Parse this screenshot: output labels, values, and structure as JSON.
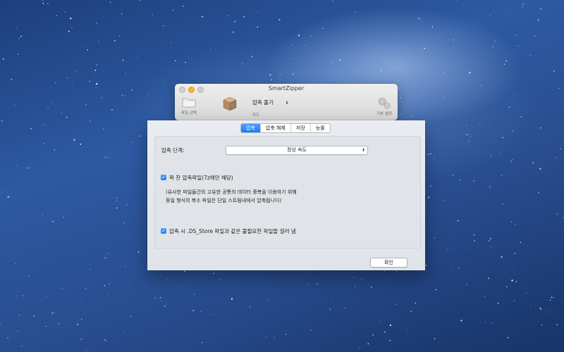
{
  "app": {
    "title": "SmartZipper"
  },
  "toolbar": {
    "file_label": "파일 선택",
    "mode_value": "압축 풀기",
    "mode_label": "모드",
    "settings_label": "기본 설정"
  },
  "preferences": {
    "tabs": [
      "압축",
      "압축 해제",
      "저장",
      "능률"
    ],
    "active_tab": "압축",
    "level_label": "압축 단계:",
    "level_value": "정상 속도",
    "solid_option": "꽉 찬 압축파일(7z에만 해당)",
    "solid_checked": true,
    "solid_desc_line1": "(유사한 파일들간의 고유한 공통의 데이터 중복을 이용하기 위해",
    "solid_desc_line2": "동일 형식의 복수 파일은 단일 스트림내에서 압축됩니다)",
    "dsstore_option": "압축 시 .DS_Store 파일과 같은 불필요한 파일들 걸러 냄",
    "dsstore_checked": true,
    "ok_label": "확인"
  },
  "colors": {
    "accent": "#1d7cf2",
    "minimize": "#f5b62b"
  }
}
